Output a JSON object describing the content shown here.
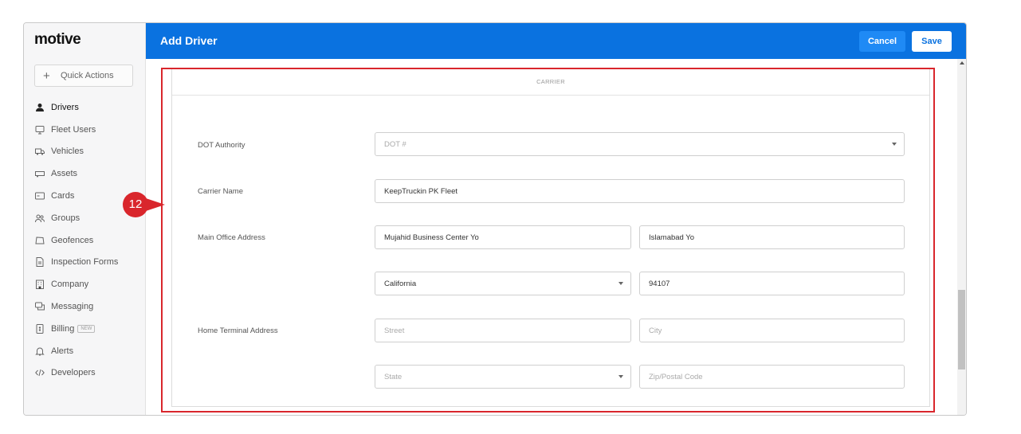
{
  "app": {
    "logo": "motive"
  },
  "sidebar": {
    "quick_actions": "Quick Actions",
    "items": [
      {
        "label": "Drivers",
        "icon": "person-icon"
      },
      {
        "label": "Fleet Users",
        "icon": "monitor-icon"
      },
      {
        "label": "Vehicles",
        "icon": "truck-icon"
      },
      {
        "label": "Assets",
        "icon": "trailer-icon"
      },
      {
        "label": "Cards",
        "icon": "card-icon"
      },
      {
        "label": "Groups",
        "icon": "groups-icon"
      },
      {
        "label": "Geofences",
        "icon": "geofence-icon"
      },
      {
        "label": "Inspection Forms",
        "icon": "document-icon"
      },
      {
        "label": "Company",
        "icon": "building-icon"
      },
      {
        "label": "Messaging",
        "icon": "chat-icon"
      },
      {
        "label": "Billing",
        "icon": "billing-icon",
        "badge": "NEW"
      },
      {
        "label": "Alerts",
        "icon": "bell-icon"
      },
      {
        "label": "Developers",
        "icon": "code-icon"
      }
    ]
  },
  "header": {
    "title": "Add Driver",
    "cancel_label": "Cancel",
    "save_label": "Save"
  },
  "carrier": {
    "section_title": "CARRIER",
    "dot_authority": {
      "label": "DOT Authority",
      "placeholder": "DOT #"
    },
    "carrier_name": {
      "label": "Carrier Name",
      "value": "KeepTruckin PK Fleet"
    },
    "main_office": {
      "label": "Main Office Address",
      "street": "Mujahid Business Center Yo",
      "city": "Islamabad Yo",
      "state": "California",
      "zip": "94107"
    },
    "home_terminal": {
      "label": "Home Terminal Address",
      "street_placeholder": "Street",
      "city_placeholder": "City",
      "state_placeholder": "State",
      "zip_placeholder": "Zip/Postal Code"
    }
  },
  "annotation": {
    "step": "12",
    "color": "#d9262c"
  },
  "colors": {
    "accent": "#0a72e0"
  }
}
